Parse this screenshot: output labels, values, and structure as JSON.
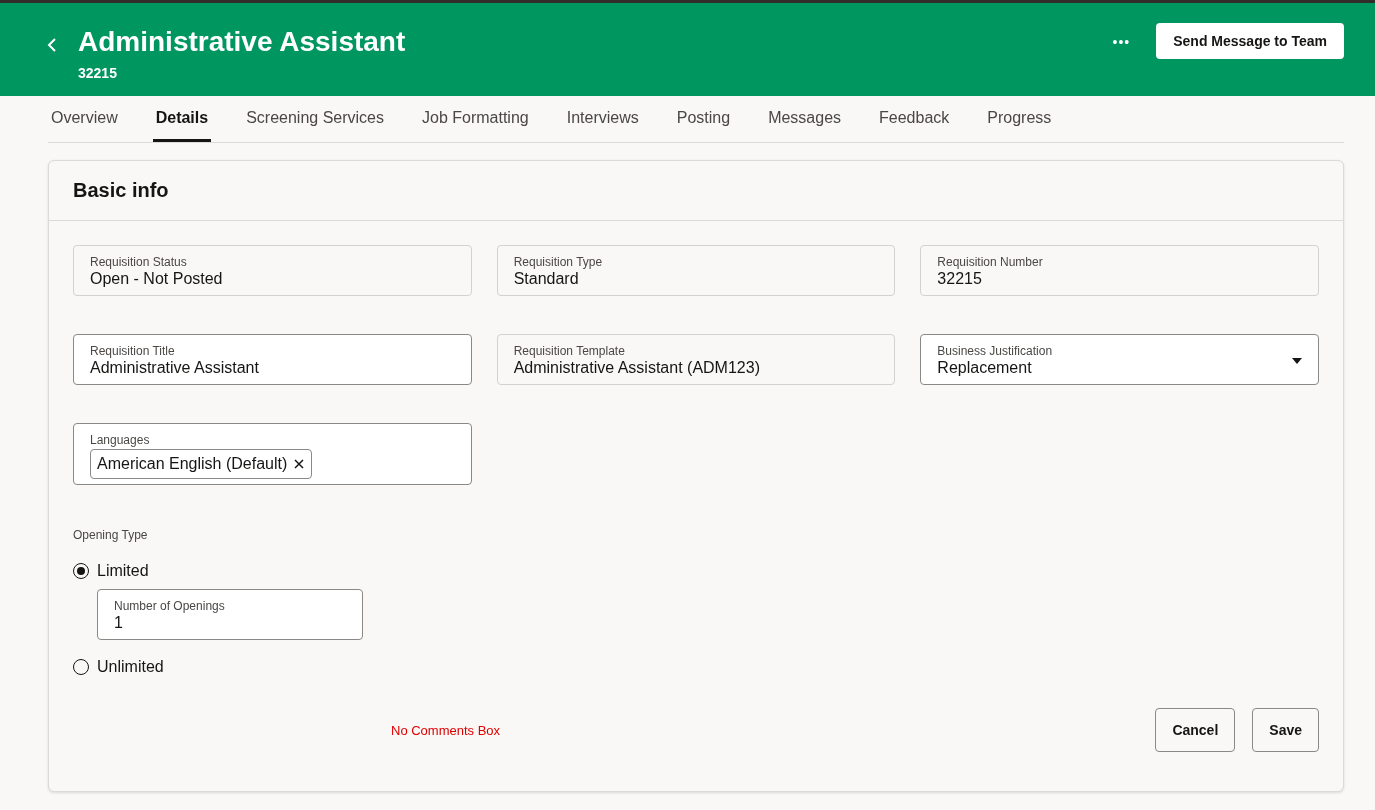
{
  "header": {
    "title": "Administrative Assistant",
    "subtitle": "32215",
    "more_menu": "•••",
    "action_button": "Send Message to Team"
  },
  "tabs": [
    {
      "label": "Overview",
      "selected": false
    },
    {
      "label": "Details",
      "selected": true
    },
    {
      "label": "Screening Services",
      "selected": false
    },
    {
      "label": "Job Formatting",
      "selected": false
    },
    {
      "label": "Interviews",
      "selected": false
    },
    {
      "label": "Posting",
      "selected": false
    },
    {
      "label": "Messages",
      "selected": false
    },
    {
      "label": "Feedback",
      "selected": false
    },
    {
      "label": "Progress",
      "selected": false
    }
  ],
  "section": {
    "title": "Basic info",
    "fields": [
      {
        "kind": "readonly",
        "label": "Requisition Status",
        "value": "Open - Not Posted"
      },
      {
        "kind": "readonly",
        "label": "Requisition Type",
        "value": "Standard"
      },
      {
        "kind": "readonly",
        "label": "Requisition Number",
        "value": "32215"
      },
      {
        "kind": "text",
        "label": "Requisition Title",
        "value": "Administrative Assistant"
      },
      {
        "kind": "readonly",
        "label": "Requisition Template",
        "value": "Administrative Assistant (ADM123)"
      },
      {
        "kind": "select",
        "label": "Business Justification",
        "value": "Replacement"
      },
      {
        "kind": "chips",
        "label": "Languages",
        "chips": [
          "American English (Default)"
        ]
      }
    ],
    "opening_type": {
      "label": "Opening Type",
      "options": [
        {
          "label": "Limited",
          "selected": true,
          "sub_field": {
            "label": "Number of Openings",
            "value": "1"
          }
        },
        {
          "label": "Unlimited",
          "selected": false
        }
      ]
    },
    "note": "No Comments Box",
    "buttons": [
      "Cancel",
      "Save"
    ]
  }
}
